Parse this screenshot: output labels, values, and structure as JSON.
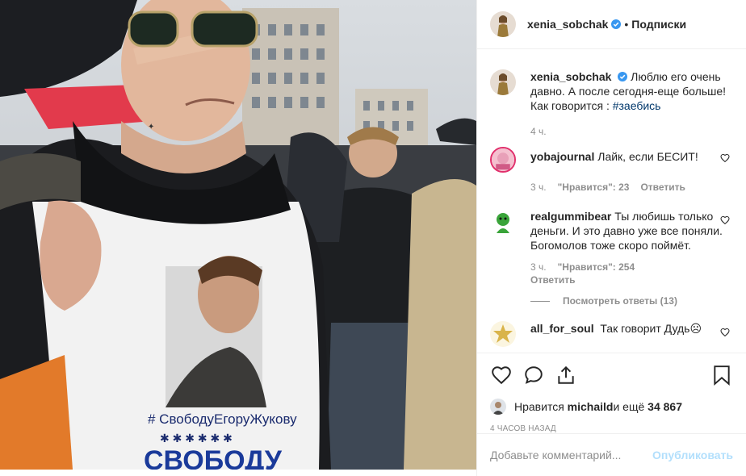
{
  "header": {
    "username": "xenia_sobchak",
    "separator": "•",
    "follow_label": "Подписки"
  },
  "photo": {
    "shirt_text": "# СвободуЕгоруЖукову",
    "shirt_stars": "✱ ✱ ✱ ✱ ✱ ✱",
    "shirt_big": "СВОБОДУ"
  },
  "caption": {
    "username": "xenia_sobchak",
    "text": "Люблю его очень давно. А после сегодня-еще больше! Как говорится : ",
    "hashtag": "#заебись",
    "time": "4 ч."
  },
  "comments": [
    {
      "username": "yobajournal",
      "text": "Лайк, если БЕСИТ!",
      "time": "3 ч.",
      "likes": "\"Нравится\": 23",
      "reply": "Ответить"
    },
    {
      "username": "realgummibear",
      "text": "Ты любишь только деньги. И это давно уже все поняли. Богомолов тоже скоро поймёт.",
      "time": "3 ч.",
      "likes": "\"Нравится\": 254",
      "reply": "Ответить",
      "view_replies": "Посмотреть ответы (13)"
    },
    {
      "username": "all_for_soul",
      "text": "Так говорит Дудь☹"
    }
  ],
  "likes": {
    "prefix": "Нравится ",
    "user": "michaild",
    "middle": " и ещё ",
    "count": "34 867"
  },
  "time_ago": "4 ЧАСОВ НАЗАД",
  "add_comment": {
    "placeholder": "Добавьте комментарий...",
    "post_label": "Опубликовать"
  },
  "colors": {
    "verified": "#3897f0",
    "hashtag": "#00376b",
    "muted": "#8e8e8e",
    "post_disabled": "#b2dffc"
  }
}
